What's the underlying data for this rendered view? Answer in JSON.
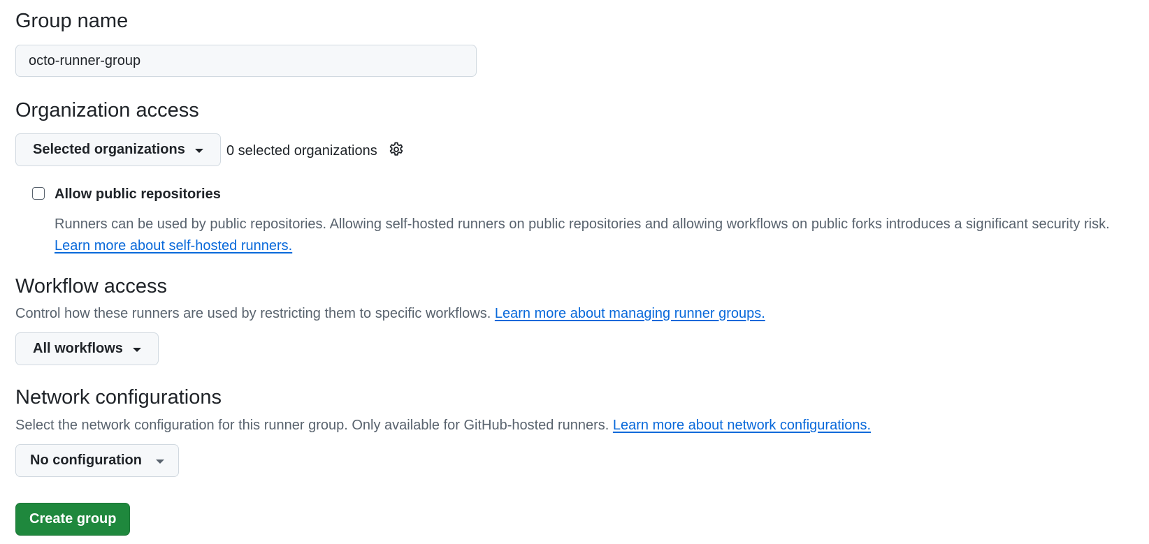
{
  "group_name": {
    "label": "Group name",
    "value": "octo-runner-group"
  },
  "organization_access": {
    "title": "Organization access",
    "dropdown_label": "Selected organizations",
    "selected_count_text": "0 selected organizations",
    "settings_icon": "gear-icon",
    "allow_public": {
      "label": "Allow public repositories",
      "checked": false,
      "description": "Runners can be used by public repositories. Allowing self-hosted runners on public repositories and allowing workflows on public forks introduces a significant security risk.",
      "link_text": "Learn more about self-hosted runners."
    }
  },
  "workflow_access": {
    "title": "Workflow access",
    "description": "Control how these runners are used by restricting them to specific workflows.",
    "link_text": "Learn more about managing runner groups.",
    "dropdown_label": "All workflows"
  },
  "network_configurations": {
    "title": "Network configurations",
    "description": "Select the network configuration for this runner group. Only available for GitHub-hosted runners.",
    "link_text": "Learn more about network configurations.",
    "dropdown_label": "No configuration"
  },
  "actions": {
    "create_label": "Create group"
  },
  "colors": {
    "primary_button": "#1f883d",
    "link": "#0969da",
    "muted_text": "#59636e",
    "text": "#1f2328",
    "input_bg": "#f6f8fa",
    "border": "#d1d9e0"
  }
}
